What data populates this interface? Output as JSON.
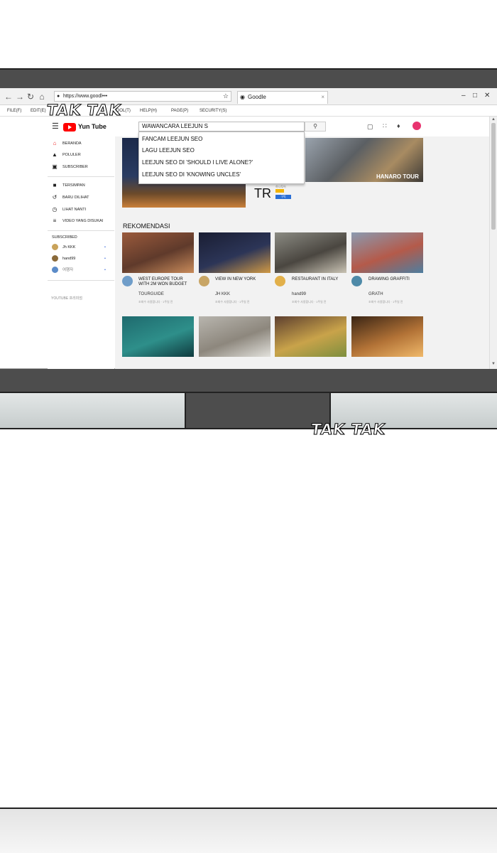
{
  "browser": {
    "url": "https://www.goodl•••",
    "tab_title": "Goodle",
    "tab_close": "×",
    "menu": [
      "FILE(F)",
      "EDIT(E)",
      "TOOL(T)",
      "HELP(H)",
      "PAGE(P)",
      "SECURITY(S)"
    ]
  },
  "sfx": {
    "one": "TAK TAK",
    "two": "TAK TAK"
  },
  "yt": {
    "logo_text": "Yun Tube",
    "search_value": "WAWANCARA LEEJUN S",
    "suggestions": [
      "FANCAM LEEJUN SEO",
      "LAGU LEEJUN SEO",
      "LEEJUN SEO DI 'SHOULD I LIVE ALONE?'",
      "LEEJUN SEO DI 'KNOWING UNCLES'"
    ],
    "sidebar": [
      {
        "label": "BERANDA",
        "icon": "home-icon"
      },
      {
        "label": "POLULER",
        "icon": "fire-icon"
      },
      {
        "label": "SUBSCRIBER",
        "icon": "subscriptions-icon"
      },
      {
        "label": "TERSIMPAN",
        "icon": "folder-icon"
      },
      {
        "label": "BARU DILIHAT",
        "icon": "history-icon"
      },
      {
        "label": "LIHAT NANTI",
        "icon": "clock-icon"
      },
      {
        "label": "VIDEO YANG DISUKAI",
        "icon": "liked-icon"
      }
    ],
    "subscribed_heading": "SUBSCRIBED",
    "subscribed": [
      {
        "label": "Jh KKK"
      },
      {
        "label": "hand99"
      },
      {
        "label": "여행자"
      }
    ],
    "youtube_premium": "YOUTUBE 프리미엄",
    "banner_label": "HANARO TOUR",
    "banner_tr": "TR",
    "banner_small_1": "하나투어",
    "banner_small_2": "구독",
    "section_title": "REKOMENDASI",
    "videos": [
      {
        "title": "WEST EUROPE TOUR WITH 2M WON BUDGET",
        "channel": "TOURGUIDE",
        "meta": "조회수 사용합니다 · 1주일 전",
        "colors": [
          "#9a5a3c",
          "#5f3a2b",
          "#c98b5a"
        ]
      },
      {
        "title": "VIEW IN NEW YORK",
        "channel": "JH KKK",
        "meta": "조회수 사용합니다 · 1주일 전",
        "colors": [
          "#1a1e33",
          "#2c3557",
          "#d19a45"
        ]
      },
      {
        "title": "RESTAURANT IN ITALY",
        "channel": "hand99",
        "meta": "조회수 사용합니다 · 1주일 전",
        "colors": [
          "#8b8b83",
          "#4a4640",
          "#c9c3b4"
        ]
      },
      {
        "title": "DRAWING GRAFFITI",
        "channel": "GRATH",
        "meta": "조회수 사용합니다 · 1주일 전",
        "colors": [
          "#8a9ab0",
          "#b45a4a",
          "#4e7ea0"
        ]
      }
    ],
    "videos_row2": [
      {
        "colors": [
          "#1f6a6e",
          "#2e8f8a",
          "#0f3a3e"
        ]
      },
      {
        "colors": [
          "#b8b5ae",
          "#8d877d",
          "#e2e1dc"
        ]
      },
      {
        "colors": [
          "#5d3f2f",
          "#c9a34a",
          "#7d8f3e"
        ]
      },
      {
        "colors": [
          "#3a2515",
          "#b27236",
          "#f0b96a"
        ]
      }
    ]
  },
  "colors": {
    "accent": "#ff0000",
    "panel": "#4d4d4d"
  }
}
